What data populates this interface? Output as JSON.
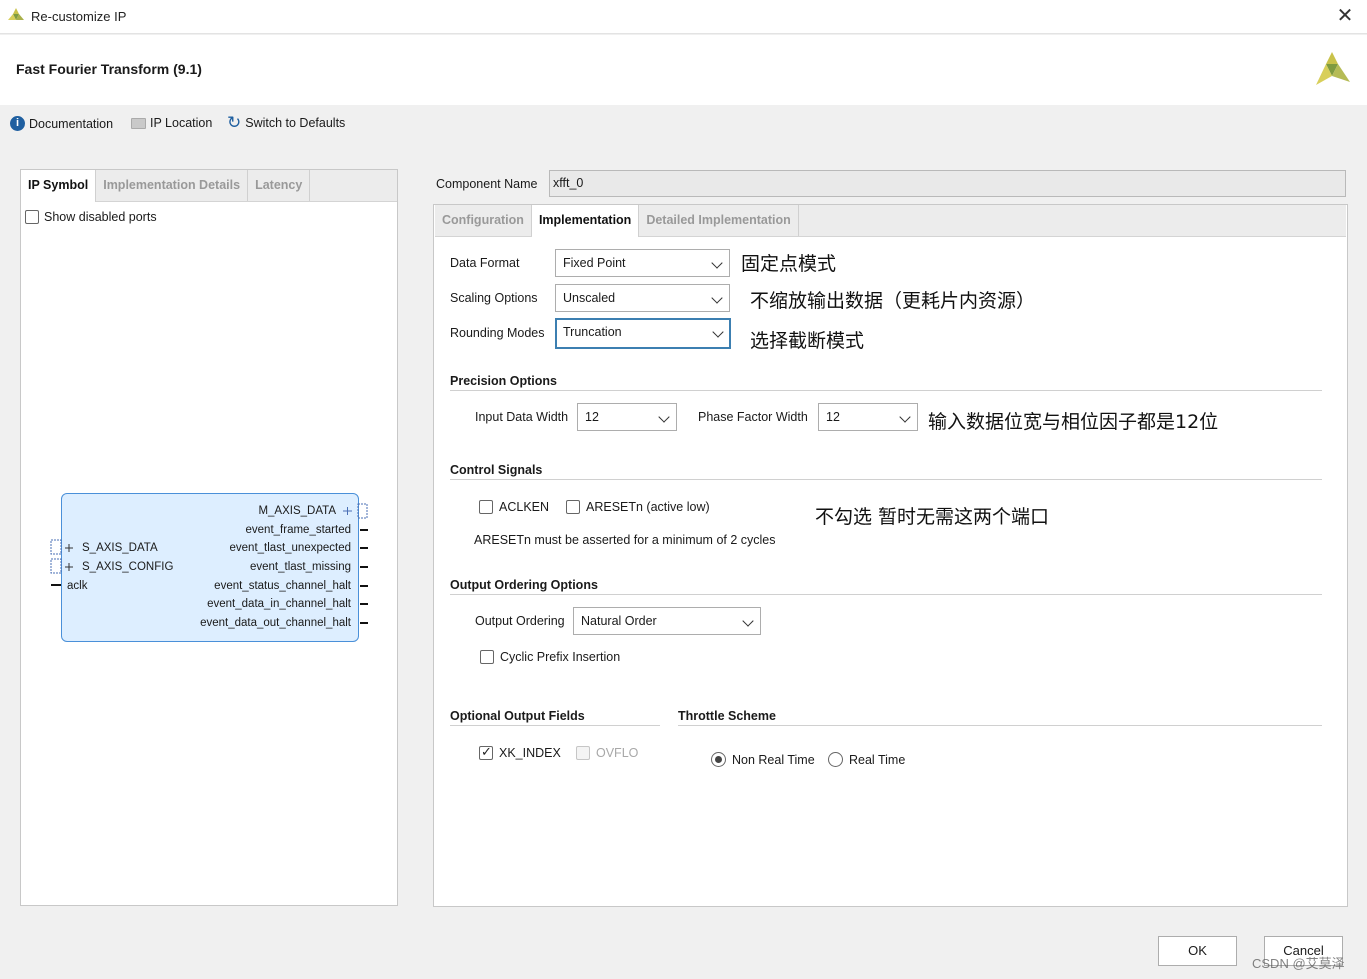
{
  "window": {
    "title": "Re-customize IP"
  },
  "header": {
    "ip_title": "Fast Fourier Transform (9.1)"
  },
  "toolbar": {
    "documentation": "Documentation",
    "ip_location": "IP Location",
    "switch_defaults": "Switch to Defaults"
  },
  "left_panel": {
    "tabs": [
      "IP Symbol",
      "Implementation Details",
      "Latency"
    ],
    "show_disabled_ports": "Show disabled ports",
    "symbol": {
      "left_ports": [
        "S_AXIS_DATA",
        "S_AXIS_CONFIG",
        "aclk"
      ],
      "right_ports": [
        "M_AXIS_DATA",
        "event_frame_started",
        "event_tlast_unexpected",
        "event_tlast_missing",
        "event_status_channel_halt",
        "event_data_in_channel_halt",
        "event_data_out_channel_halt"
      ]
    }
  },
  "component": {
    "label": "Component Name",
    "value": "xfft_0"
  },
  "right_tabs": [
    "Configuration",
    "Implementation",
    "Detailed Implementation"
  ],
  "implementation": {
    "data_format": {
      "label": "Data Format",
      "value": "Fixed Point"
    },
    "scaling_options": {
      "label": "Scaling Options",
      "value": "Unscaled"
    },
    "rounding_modes": {
      "label": "Rounding Modes",
      "value": "Truncation"
    },
    "precision": {
      "title": "Precision Options",
      "input_width_label": "Input Data Width",
      "input_width_value": "12",
      "phase_width_label": "Phase Factor Width",
      "phase_width_value": "12"
    },
    "control": {
      "title": "Control Signals",
      "aclken": "ACLKEN",
      "aresetn": "ARESETn (active low)",
      "note": "ARESETn must be asserted for a minimum of 2 cycles"
    },
    "ordering": {
      "title": "Output Ordering Options",
      "label": "Output Ordering",
      "value": "Natural Order",
      "cyclic_prefix": "Cyclic Prefix Insertion"
    },
    "optional_fields": {
      "title": "Optional Output Fields",
      "xk_index": "XK_INDEX",
      "ovflo": "OVFLO"
    },
    "throttle": {
      "title": "Throttle Scheme",
      "non_real_time": "Non Real Time",
      "real_time": "Real Time"
    }
  },
  "annotations": {
    "a1": "固定点模式",
    "a2": "不缩放输出数据（更耗片内资源）",
    "a3": "选择截断模式",
    "a4": "输入数据位宽与相位因子都是12位",
    "a5": "不勾选  暂时无需这两个端口"
  },
  "buttons": {
    "ok": "OK",
    "cancel": "Cancel"
  },
  "watermark": "CSDN @艾莫泽",
  "colors": {
    "accent": "#3c7fb1",
    "logo_yellow": "#c9c24a",
    "logo_green": "#7f9b3f"
  }
}
